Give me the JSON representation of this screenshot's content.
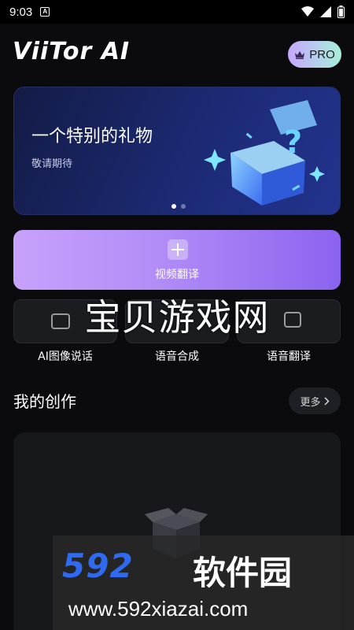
{
  "status_bar": {
    "time": "9:03",
    "notification": "A"
  },
  "header": {
    "logo": "ViiTor AI",
    "pro_label": "PRO"
  },
  "banner": {
    "title": "一个特别的礼物",
    "subtitle": "敬请期待"
  },
  "video_translate": {
    "label": "视频翻译"
  },
  "tools": [
    {
      "label": "AI图像说话"
    },
    {
      "label": "语音合成"
    },
    {
      "label": "语音翻译"
    }
  ],
  "overlay_watermark": "宝贝游戏网",
  "creations": {
    "title": "我的创作",
    "more_label": "更多"
  },
  "bottom_watermark": {
    "brand": "592",
    "brand_cn": "软件园",
    "url": "www.592xiazai.com"
  },
  "colors": {
    "accent_purple": "#b18cf7",
    "pro_gradient_start": "#c7a7ff",
    "pro_gradient_end": "#a6f0d9",
    "banner_blue": "#1c2a74"
  }
}
